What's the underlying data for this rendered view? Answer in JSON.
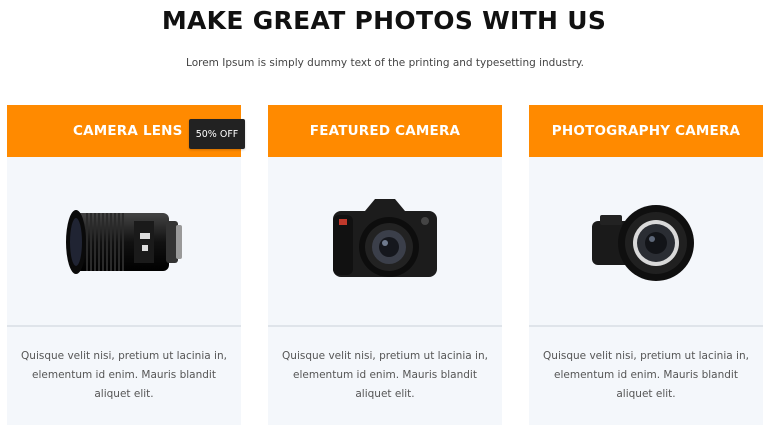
{
  "header": {
    "title": "MAKE GREAT PHOTOS WITH US",
    "subtitle": "Lorem Ipsum is simply dummy text of the printing and typesetting industry."
  },
  "cards": [
    {
      "title": "CAMERA LENS",
      "badge": "50% OFF",
      "image_icon": "camera-lens-icon",
      "description": "Quisque velit nisi, pretium ut lacinia in, elementum id enim. Mauris blandit aliquet elit."
    },
    {
      "title": "FEATURED CAMERA",
      "image_icon": "dslr-camera-icon",
      "description": "Quisque velit nisi, pretium ut lacinia in, elementum id enim. Mauris blandit aliquet elit."
    },
    {
      "title": "PHOTOGRAPHY CAMERA",
      "image_icon": "mirrorless-camera-icon",
      "description": "Quisque velit nisi, pretium ut lacinia in, elementum id enim. Mauris blandit aliquet elit."
    }
  ],
  "colors": {
    "accent": "#ff8a00",
    "card_bg": "#f4f7fb",
    "badge_bg": "#222222"
  }
}
